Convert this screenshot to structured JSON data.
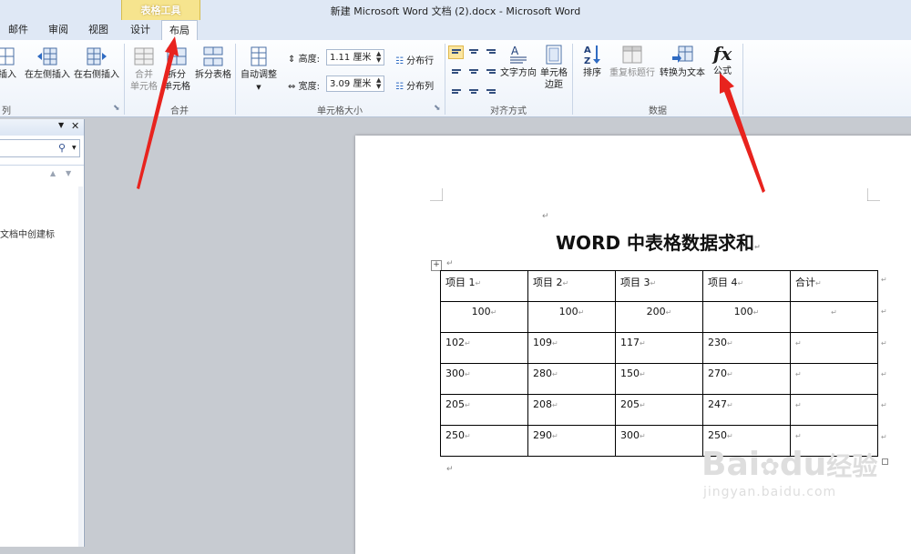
{
  "window": {
    "title": "新建 Microsoft Word 文档 (2).docx  -  Microsoft Word"
  },
  "context_group": {
    "label": "表格工具"
  },
  "tabs": [
    {
      "label": "邮件"
    },
    {
      "label": "审阅"
    },
    {
      "label": "视图"
    },
    {
      "label": "设计"
    },
    {
      "label": "布局"
    }
  ],
  "ribbon": {
    "rows_columns": {
      "insert_left_partial": "插入",
      "insert_left": "在左侧插入",
      "insert_right": "在右侧插入",
      "group_label": "列"
    },
    "merge": {
      "merge_cells_1": "合并",
      "merge_cells_2": "单元格",
      "split_cells_1": "拆分",
      "split_cells_2": "单元格",
      "split_table": "拆分表格",
      "group_label": "合并"
    },
    "cell_size": {
      "autofit": "自动调整",
      "height_label": "高度:",
      "height_value": "1.11 厘米",
      "width_label": "宽度:",
      "width_value": "3.09 厘米",
      "distribute_rows": "分布行",
      "distribute_cols": "分布列",
      "group_label": "单元格大小"
    },
    "alignment": {
      "text_direction": "文字方向",
      "cell_margins_1": "单元格",
      "cell_margins_2": "边距",
      "group_label": "对齐方式"
    },
    "data": {
      "sort": "排序",
      "repeat_header": "重复标题行",
      "convert_to_text": "转换为文本",
      "formula": "公式",
      "formula_icon": "fx",
      "group_label": "数据"
    }
  },
  "nav_pane": {
    "text": "文档中创建标"
  },
  "document": {
    "title": "WORD 中表格数据求和",
    "para_mark": "↵",
    "table_move_handle": "+",
    "table": {
      "rows": [
        [
          "项目 1",
          "项目 2",
          "项目 3",
          "项目 4",
          "合计"
        ],
        [
          "100",
          "100",
          "200",
          "100",
          ""
        ],
        [
          "102",
          "109",
          "117",
          "230",
          ""
        ],
        [
          "300",
          "280",
          "150",
          "270",
          ""
        ],
        [
          "205",
          "208",
          "205",
          "247",
          ""
        ],
        [
          "250",
          "290",
          "300",
          "250",
          ""
        ]
      ]
    }
  },
  "watermark": {
    "brand": "Bai",
    "brand2": "du",
    "product": "经验",
    "url": "jingyan.baidu.com"
  },
  "colors": {
    "arrow": "#e8231e",
    "context_tab": "#f6e48e",
    "ribbon_bg": "#eef3fa"
  }
}
